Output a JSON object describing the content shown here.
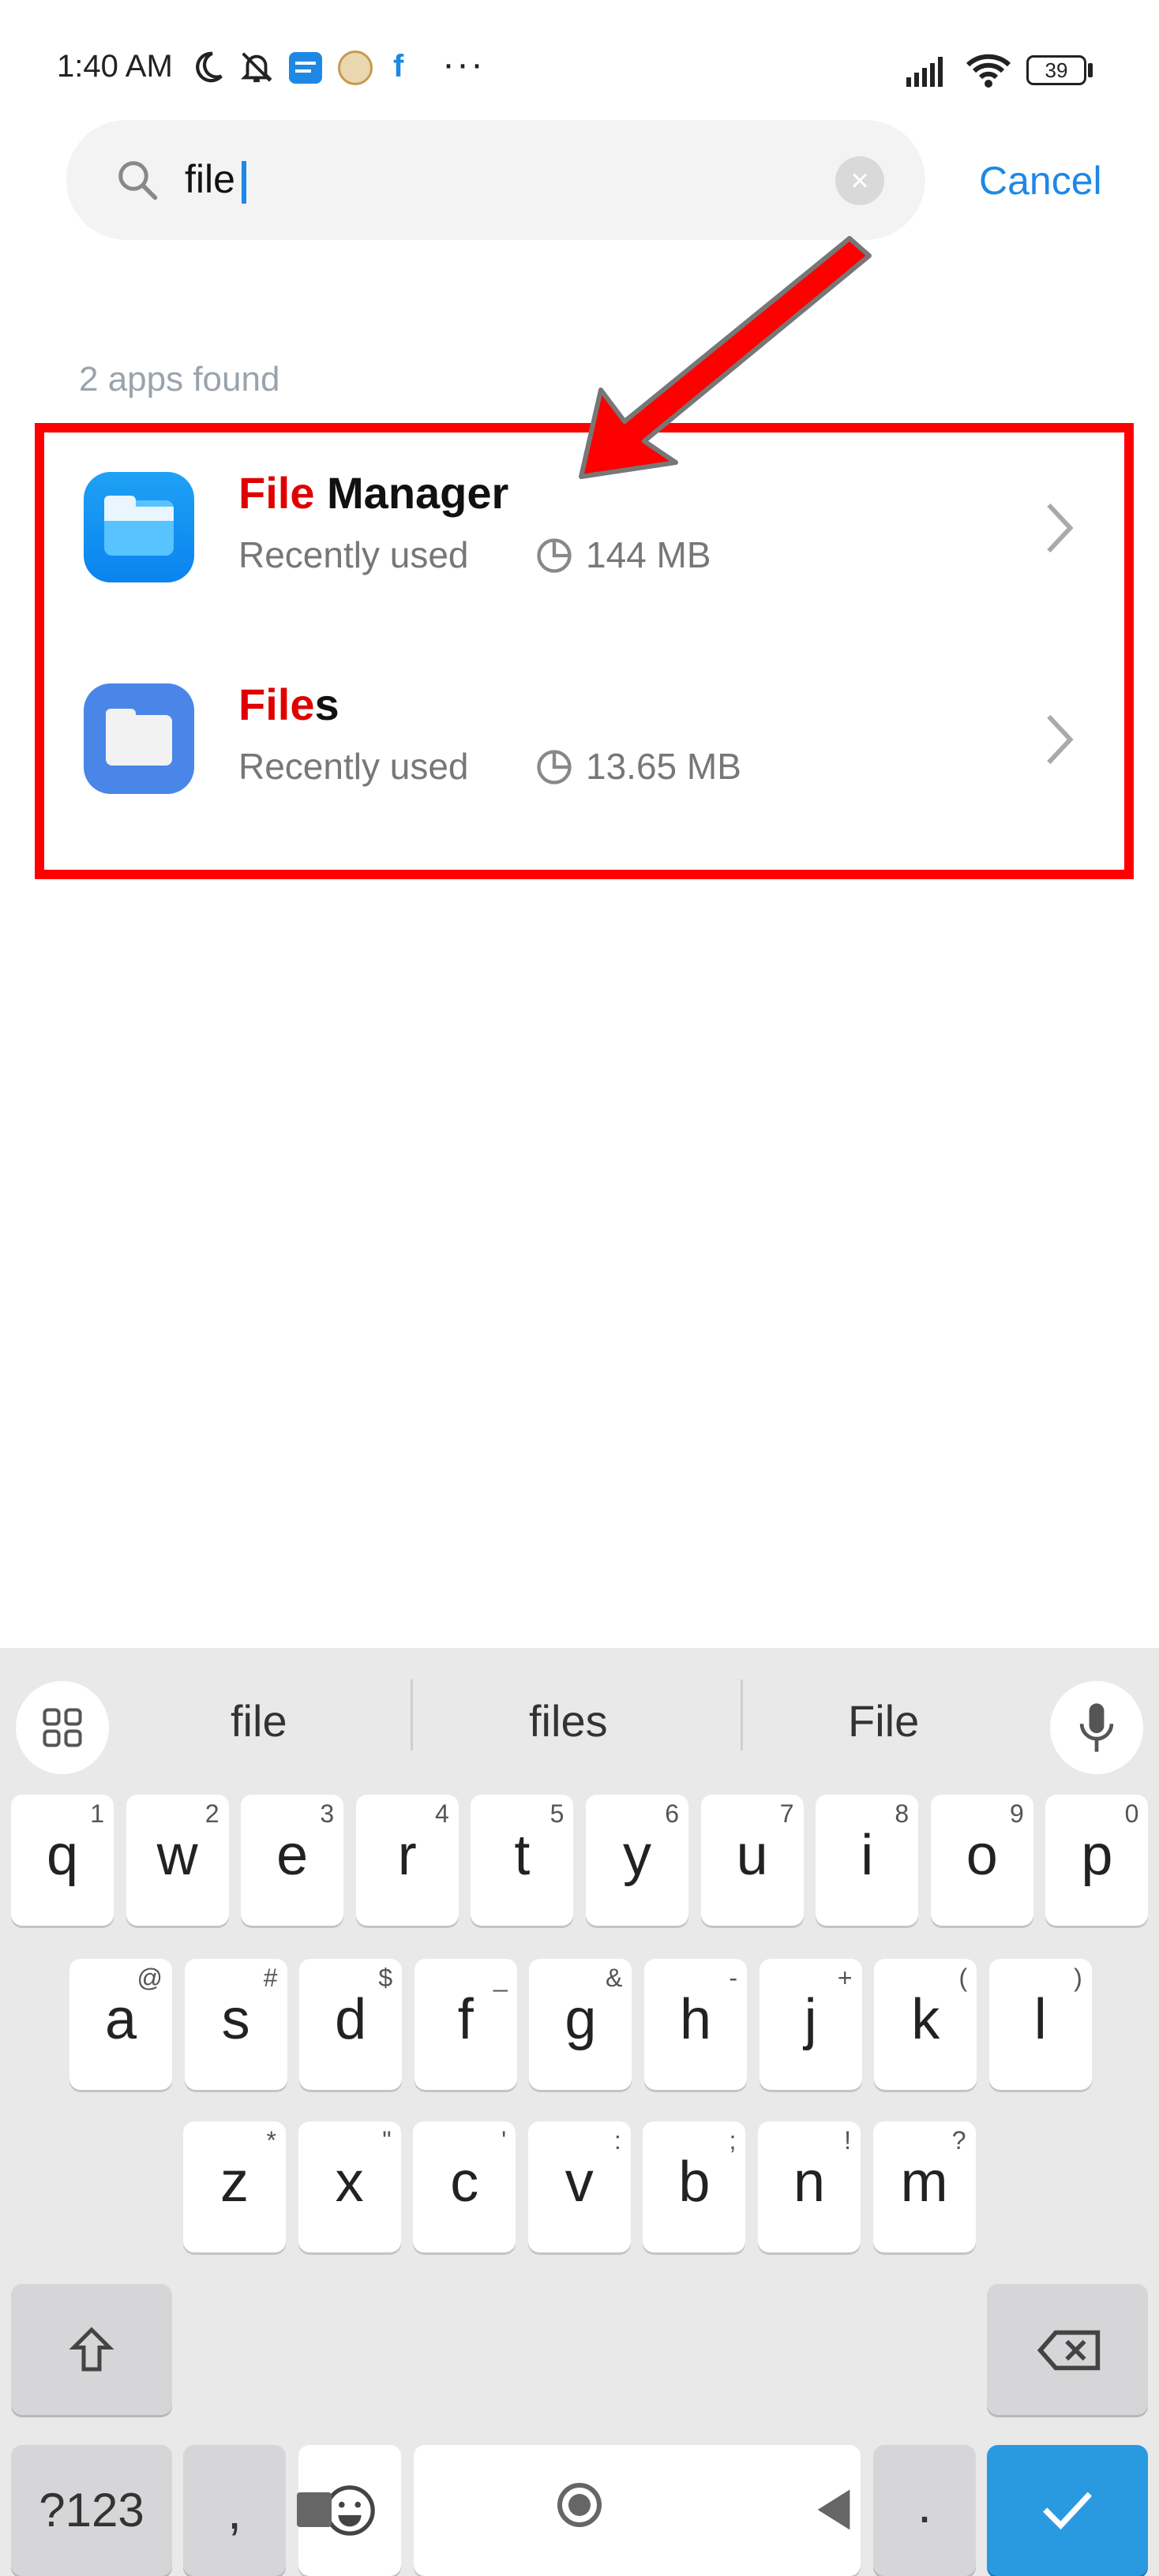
{
  "status_bar": {
    "time": "1:40 AM",
    "battery": "39",
    "icons": [
      "moon-icon",
      "mute-bell-icon",
      "message-icon",
      "app-badge-icon",
      "facebook-icon",
      "more-dots-icon",
      "signal-icon",
      "wifi-icon",
      "battery-icon"
    ],
    "facebook_letter": "f",
    "more_dots": "···"
  },
  "search": {
    "query": "file",
    "cancel_label": "Cancel",
    "clear_glyph": "×"
  },
  "results": {
    "count_text": "2 apps found",
    "items": [
      {
        "name_match": "File",
        "name_rest": " Manager",
        "subtitle": "Recently used",
        "size": "144 MB",
        "icon": "file-manager-icon"
      },
      {
        "name_match": "File",
        "name_rest": "s",
        "subtitle": "Recently used",
        "size": "13.65 MB",
        "icon": "files-icon"
      }
    ]
  },
  "annotation": {
    "arrow_color": "#ff0000",
    "box_color": "#ff0000"
  },
  "keyboard": {
    "suggestions": [
      "file",
      "files",
      "File"
    ],
    "row1": [
      {
        "k": "q",
        "s": "1"
      },
      {
        "k": "w",
        "s": "2"
      },
      {
        "k": "e",
        "s": "3"
      },
      {
        "k": "r",
        "s": "4"
      },
      {
        "k": "t",
        "s": "5"
      },
      {
        "k": "y",
        "s": "6"
      },
      {
        "k": "u",
        "s": "7"
      },
      {
        "k": "i",
        "s": "8"
      },
      {
        "k": "o",
        "s": "9"
      },
      {
        "k": "p",
        "s": "0"
      }
    ],
    "row2": [
      {
        "k": "a",
        "s": "@"
      },
      {
        "k": "s",
        "s": "#"
      },
      {
        "k": "d",
        "s": "$"
      },
      {
        "k": "f",
        "s": "_"
      },
      {
        "k": "g",
        "s": "&"
      },
      {
        "k": "h",
        "s": "-"
      },
      {
        "k": "j",
        "s": "+"
      },
      {
        "k": "k",
        "s": "("
      },
      {
        "k": "l",
        "s": ")"
      }
    ],
    "row3": [
      {
        "k": "z",
        "s": "*"
      },
      {
        "k": "x",
        "s": "\""
      },
      {
        "k": "c",
        "s": "'"
      },
      {
        "k": "v",
        "s": ":"
      },
      {
        "k": "b",
        "s": ";"
      },
      {
        "k": "n",
        "s": "!"
      },
      {
        "k": "m",
        "s": "?"
      }
    ],
    "symbols_label": "?123",
    "comma": ",",
    "period": ".",
    "accent_color": "#2a9ae0"
  }
}
